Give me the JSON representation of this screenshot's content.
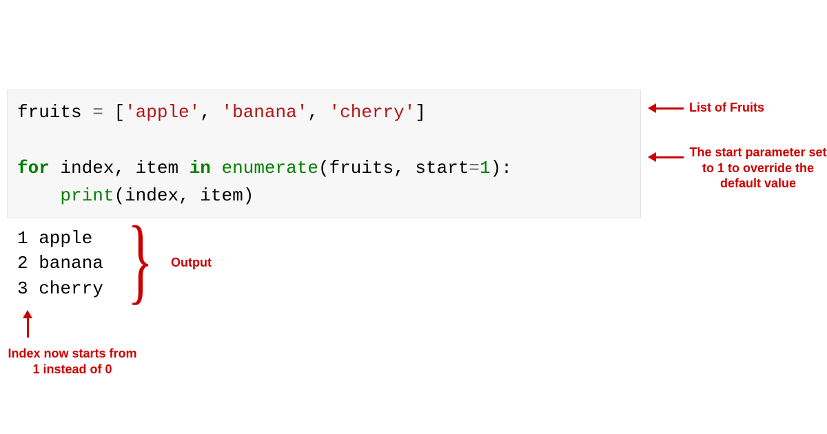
{
  "code": {
    "line1": {
      "var": "fruits",
      "op": " = ",
      "bracket_open": "[",
      "str1": "'apple'",
      "sep1": ", ",
      "str2": "'banana'",
      "sep2": ", ",
      "str3": "'cherry'",
      "bracket_close": "]"
    },
    "line2_blank": " ",
    "line3": {
      "kw_for": "for",
      "sp1": " ",
      "v1": "index",
      "comma": ", ",
      "v2": "item",
      "sp2": " ",
      "kw_in": "in",
      "sp3": " ",
      "fn": "enumerate",
      "paren_open": "(",
      "arg1": "fruits",
      "argsep": ", ",
      "kwarg": "start",
      "eq": "=",
      "num": "1",
      "paren_close": ")",
      "colon": ":"
    },
    "line4": {
      "indent": "    ",
      "fn": "print",
      "paren_open": "(",
      "arg1": "index",
      "sep": ", ",
      "arg2": "item",
      "paren_close": ")"
    }
  },
  "output": {
    "line1": "1 apple",
    "line2": "2 banana",
    "line3": "3 cherry"
  },
  "annotations": {
    "list_of_fruits": "List of Fruits",
    "start_param": "The start parameter set to 1 to override the default value",
    "output_label": "Output",
    "index_note": "Index now starts from 1 instead of 0"
  },
  "brace": "}"
}
